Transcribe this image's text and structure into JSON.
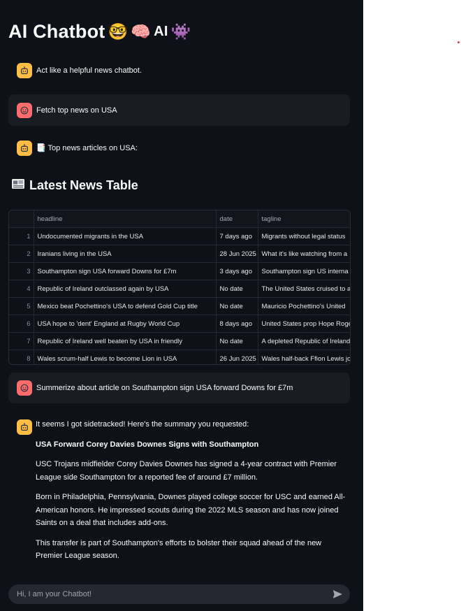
{
  "title": {
    "text": "AI Chatbot",
    "suffix_ai": "AI"
  },
  "messages": [
    {
      "role": "bot",
      "text": "Act like a helpful news chatbot."
    },
    {
      "role": "user",
      "text": "Fetch top news on USA"
    },
    {
      "role": "bot",
      "text": "📑 Top news articles on USA:"
    },
    {
      "role": "user",
      "text": "Summerize about article on Southampton sign USA forward Downs for £7m"
    }
  ],
  "news_section": {
    "title": "Latest News Table"
  },
  "news_table": {
    "columns": [
      "headline",
      "date",
      "tagline"
    ],
    "rows": [
      {
        "idx": "1",
        "headline": "Undocumented migrants in the USA",
        "date": "7 days ago",
        "tagline": "Migrants without legal status"
      },
      {
        "idx": "2",
        "headline": "Iranians living in the USA",
        "date": "28 Jun 2025",
        "tagline": "What it's like watching from a"
      },
      {
        "idx": "3",
        "headline": "Southampton sign USA forward Downs for £7m",
        "date": "3 days ago",
        "tagline": "Southampton sign US interna"
      },
      {
        "idx": "4",
        "headline": "Republic of Ireland outclassed again by USA",
        "date": "No date",
        "tagline": "The United States cruised to a"
      },
      {
        "idx": "5",
        "headline": "Mexico beat Pochettino's USA to defend Gold Cup title",
        "date": "No date",
        "tagline": "Mauricio Pochettino's United"
      },
      {
        "idx": "6",
        "headline": "USA hope to 'dent' England at Rugby World Cup",
        "date": "8 days ago",
        "tagline": "United States prop Hope Roge"
      },
      {
        "idx": "7",
        "headline": "Republic of Ireland well beaten by USA in friendly",
        "date": "No date",
        "tagline": "A depleted Republic of Ireland"
      },
      {
        "idx": "8",
        "headline": "Wales scrum-half Lewis to become Lion in USA",
        "date": "26 Jun 2025",
        "tagline": "Wales half-back Ffion Lewis jo"
      }
    ]
  },
  "answer": {
    "lead": "It seems I got sidetracked! Here's the summary you requested:",
    "headline": "USA Forward Corey Davies Downes Signs with Southampton",
    "paragraphs": [
      "USC Trojans midfielder Corey Davies Downes has signed a 4-year contract with Premier League side Southampton for a reported fee of around £7 million.",
      "Born in Philadelphia, Pennsylvania, Downes played college soccer for USC and earned All-American honors. He impressed scouts during the 2022 MLS season and has now joined Saints on a deal that includes add-ons.",
      "This transfer is part of Southampton's efforts to bolster their squad ahead of the new Premier League season."
    ]
  },
  "chat_input": {
    "placeholder": "Hi, I am your Chatbot!"
  },
  "icons": {
    "bot_avatar": "robot-face-icon",
    "user_avatar": "smiley-face-icon",
    "send": "send-arrow-icon",
    "newspaper": "newspaper-icon"
  },
  "colors": {
    "background": "#0e1117",
    "bot_avatar": "#ffbd45",
    "user_avatar": "#ff6c6c",
    "user_bubble": "#1a1c24",
    "input_bg": "#262730"
  }
}
